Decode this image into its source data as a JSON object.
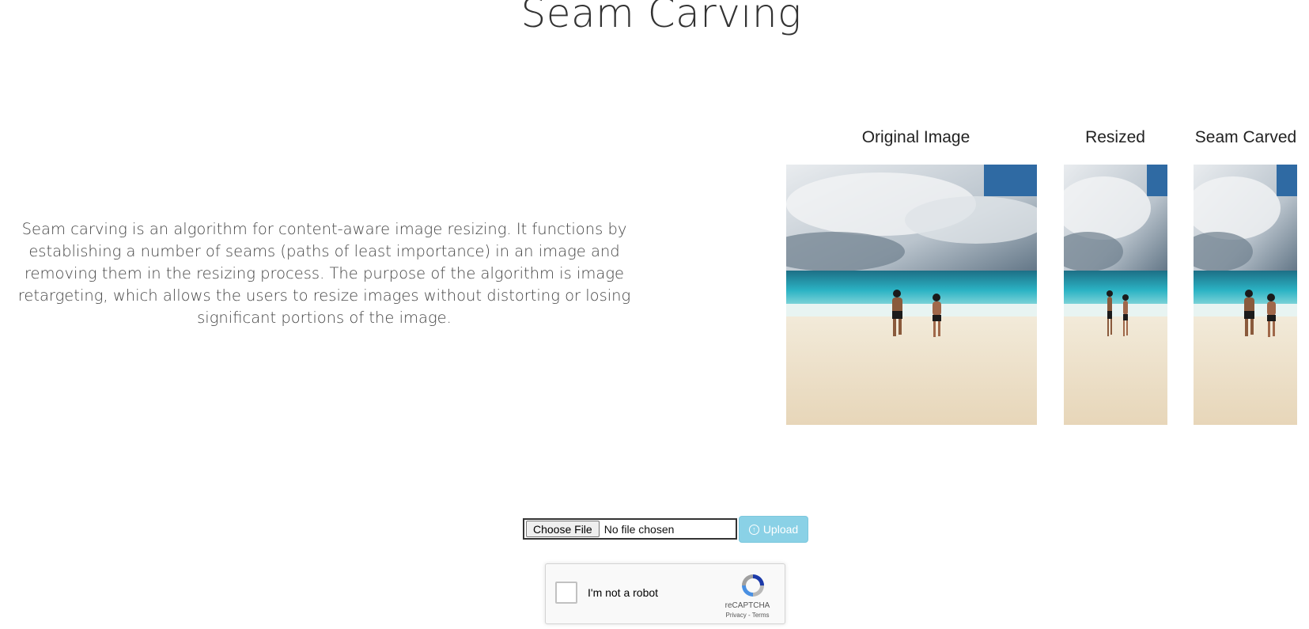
{
  "page": {
    "title": "Seam Carving",
    "description": "Seam carving is an algorithm for content-aware image resizing. It functions by establishing a number of seams (paths of least importance) in an image and removing them in the resizing process. The purpose of the algorithm is image retargeting, which allows the users to resize images without distorting or losing significant portions of the image."
  },
  "images": [
    {
      "label": "Original Image",
      "icon": "beach-couple-photo"
    },
    {
      "label": "Resized",
      "icon": "beach-couple-photo-squeezed"
    },
    {
      "label": "Seam Carved",
      "icon": "beach-couple-photo-carved"
    }
  ],
  "upload": {
    "choose_label": "Choose File",
    "status": "No file chosen",
    "upload_label": "Upload",
    "accent": "#8ad1e6"
  },
  "recaptcha": {
    "label": "I'm not a robot",
    "brand": "reCAPTCHA",
    "links": "Privacy - Terms"
  }
}
